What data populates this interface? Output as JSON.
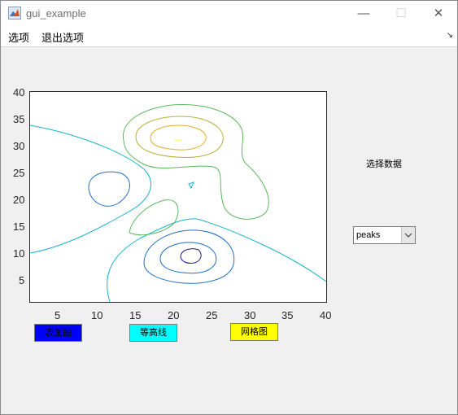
{
  "window": {
    "title": "gui_example",
    "icon": "matlab-icon",
    "controls": {
      "minimize": "—",
      "maximize": "☐",
      "close": "✕"
    }
  },
  "menu": [
    {
      "label": "选项"
    },
    {
      "label": "退出选项"
    }
  ],
  "plot": {
    "x_ticks": [
      "5",
      "10",
      "15",
      "20",
      "25",
      "30",
      "35",
      "40"
    ],
    "y_ticks": [
      "40",
      "35",
      "30",
      "25",
      "20",
      "15",
      "10",
      "5"
    ]
  },
  "buttons": [
    {
      "label": "表面图",
      "color": "#0000ff"
    },
    {
      "label": "等高线",
      "color": "#00ffff"
    },
    {
      "label": "网格图",
      "color": "#ffff00"
    }
  ],
  "selector": {
    "label": "选择数据",
    "value": "peaks"
  },
  "colors": {
    "level_dark": "#1f1f8c",
    "level_blue": "#1f6fc9",
    "level_cyan": "#14b4c8",
    "level_green": "#5cb85c",
    "level_olive": "#b4b43c",
    "level_orange": "#e0b030",
    "level_yellow": "#ffff00"
  }
}
